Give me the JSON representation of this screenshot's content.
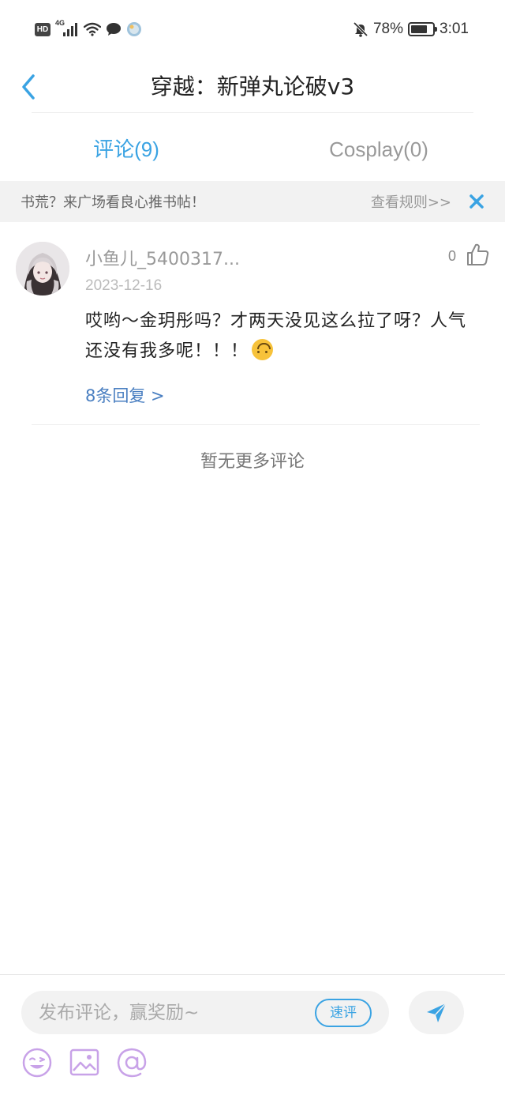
{
  "status_bar": {
    "hd": "HD",
    "network": "4G",
    "battery_percent": "78%",
    "battery_level": 0.78,
    "time": "3:01"
  },
  "header": {
    "title": "穿越：新弹丸论破v3"
  },
  "tabs": [
    {
      "label": "评论(9)",
      "active": true
    },
    {
      "label": "Cosplay(0)",
      "active": false
    }
  ],
  "notice": {
    "text": "书荒？来广场看良心推书帖！",
    "rules_link": "查看规则>>"
  },
  "comments": [
    {
      "username": "小鱼儿_5400317...",
      "date": "2023-12-16",
      "likes": "0",
      "body": "哎哟～金玥彤吗？才两天没见这么拉了呀？人气还没有我多呢！！！",
      "reply_link": "8条回复 >"
    }
  ],
  "no_more_text": "暂无更多评论",
  "composer": {
    "placeholder": "发布评论，赢奖励~",
    "quick_label": "速评"
  },
  "colors": {
    "accent": "#3aa3e3",
    "reply_link": "#4a7fc1",
    "tool_purple": "#c8a2e8"
  },
  "icons": {
    "back": "chevron-left-icon",
    "close": "close-icon",
    "like": "thumbs-up-icon",
    "send": "paper-plane-icon",
    "emoji": "smile-wink-icon",
    "image": "image-icon",
    "mention": "at-sign-icon"
  }
}
